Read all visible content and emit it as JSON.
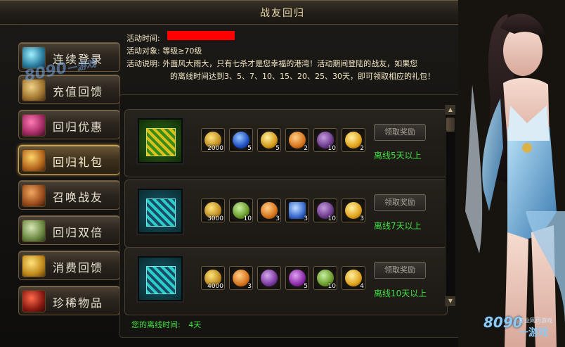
{
  "window": {
    "title": "战友回归",
    "close_label": "✕"
  },
  "sidebar": {
    "items": [
      {
        "label": "连续登录",
        "icon": "key-icon",
        "active": false
      },
      {
        "label": "充值回馈",
        "icon": "scroll-icon",
        "active": false
      },
      {
        "label": "回归优惠",
        "icon": "gift-boxes-icon",
        "active": false
      },
      {
        "label": "回归礼包",
        "icon": "treasure-chest-icon",
        "active": true
      },
      {
        "label": "召唤战友",
        "icon": "banner-icon",
        "active": false
      },
      {
        "label": "回归双倍",
        "icon": "exp-scroll-icon",
        "active": false
      },
      {
        "label": "消费回馈",
        "icon": "gold-pile-icon",
        "active": false
      },
      {
        "label": "珍稀物品",
        "icon": "demon-mask-icon",
        "active": false
      }
    ]
  },
  "info": {
    "time_label": "活动时间:",
    "target_label": "活动对象:",
    "target_value": "等级≥70级",
    "desc_label": "活动说明:",
    "desc_line1": "外面风大雨大，只有七杀才是您幸福的港湾！活动期间登陆的战友，如果您",
    "desc_line2": "的离线时间达到3、5、7、10、15、20、25、30天，即可领取相应的礼包！"
  },
  "rewards": [
    {
      "gift_color": "green",
      "claim_label": "领取奖励",
      "condition": "离线5天以上",
      "items": [
        {
          "icon": "gold-ingot-icon",
          "count": "2000"
        },
        {
          "icon": "blue-orb-icon",
          "count": "5"
        },
        {
          "icon": "gold-star-icon",
          "count": "5"
        },
        {
          "icon": "fire-coin-icon",
          "count": "2"
        },
        {
          "icon": "purple-scroll-icon",
          "count": "10"
        },
        {
          "icon": "gold-coin-icon",
          "count": "2"
        }
      ]
    },
    {
      "gift_color": "blue",
      "claim_label": "领取奖励",
      "condition": "离线7天以上",
      "items": [
        {
          "icon": "gold-ingot-icon",
          "count": "3000"
        },
        {
          "icon": "jade-jewel-icon",
          "count": "10"
        },
        {
          "icon": "fire-coin-icon",
          "count": "3"
        },
        {
          "icon": "blue-talisman-icon",
          "count": "3"
        },
        {
          "icon": "purple-scroll-icon",
          "count": "10"
        },
        {
          "icon": "gold-coin-icon",
          "count": "3"
        }
      ]
    },
    {
      "gift_color": "blue",
      "claim_label": "领取奖励",
      "condition": "离线10天以上",
      "items": [
        {
          "icon": "gold-ingot-icon",
          "count": "4000"
        },
        {
          "icon": "fire-coin-icon",
          "count": "3"
        },
        {
          "icon": "purple-bone-icon",
          "count": ""
        },
        {
          "icon": "purple-scroll-icon",
          "count": "5"
        },
        {
          "icon": "jade-jewel-icon",
          "count": "10"
        },
        {
          "icon": "gold-coin-icon",
          "count": "4"
        }
      ]
    }
  ],
  "status": {
    "offline_label": "您的离线时间:",
    "offline_value": "4天"
  },
  "watermark": {
    "brand": "8090",
    "slogan": "一游戏",
    "sub": "专业网页游戏"
  },
  "colors": {
    "highlight_green": "#3fe040",
    "gold": "#e9d9a8",
    "red_redaction": "#ff0000"
  }
}
